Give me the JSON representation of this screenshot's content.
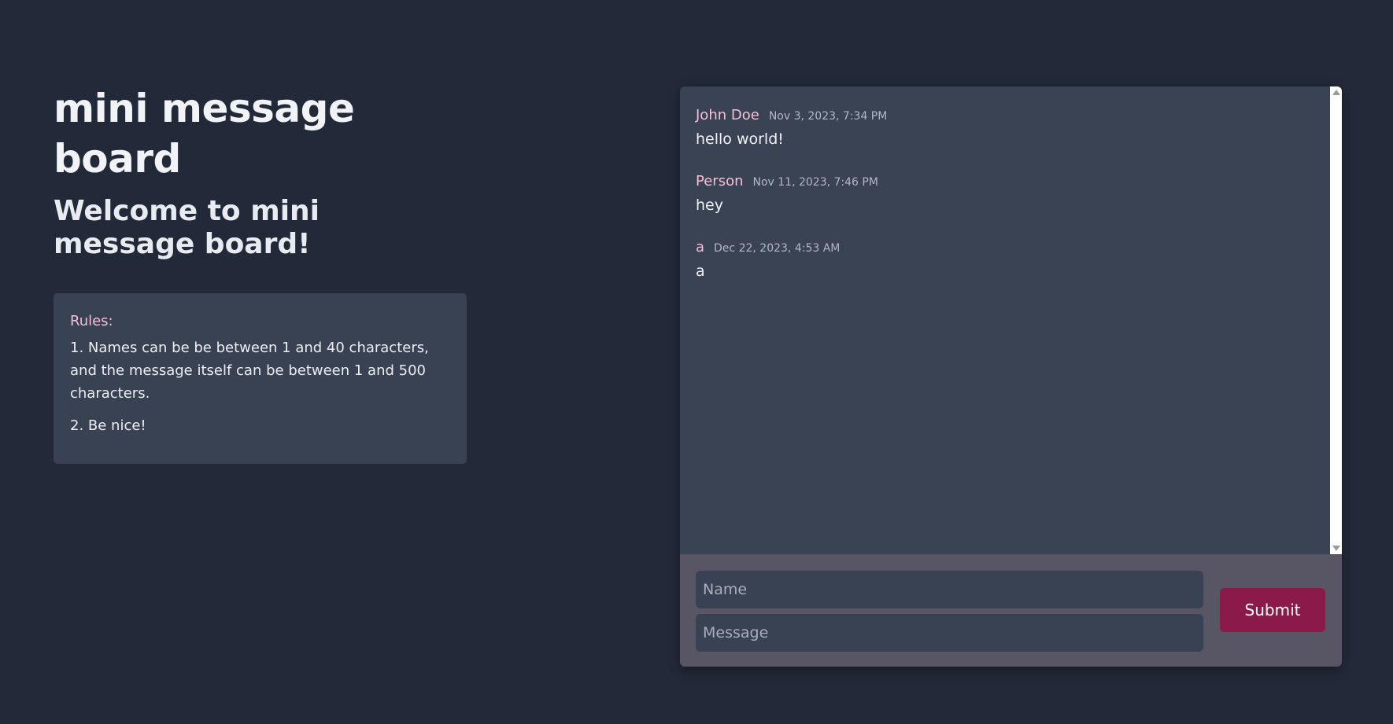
{
  "header": {
    "title": "mini message board",
    "welcome": "Welcome to mini message board!"
  },
  "rules": {
    "title": "Rules:",
    "items": [
      "1. Names can be be between 1 and 40 characters, and the message itself can be between 1 and 500 characters.",
      "2. Be nice!"
    ]
  },
  "messages": [
    {
      "author": "John Doe",
      "time": "Nov 3, 2023, 7:34 PM",
      "text": "hello world!"
    },
    {
      "author": "Person",
      "time": "Nov 11, 2023, 7:46 PM",
      "text": "hey"
    },
    {
      "author": "a",
      "time": "Dec 22, 2023, 4:53 AM",
      "text": "a"
    }
  ],
  "form": {
    "name_placeholder": "Name",
    "message_placeholder": "Message",
    "submit_label": "Submit"
  },
  "colors": {
    "background": "#222938",
    "panel": "#3a4354",
    "composer": "#585565",
    "accent_pink": "#f6bfd8",
    "submit": "#8c1a48"
  }
}
